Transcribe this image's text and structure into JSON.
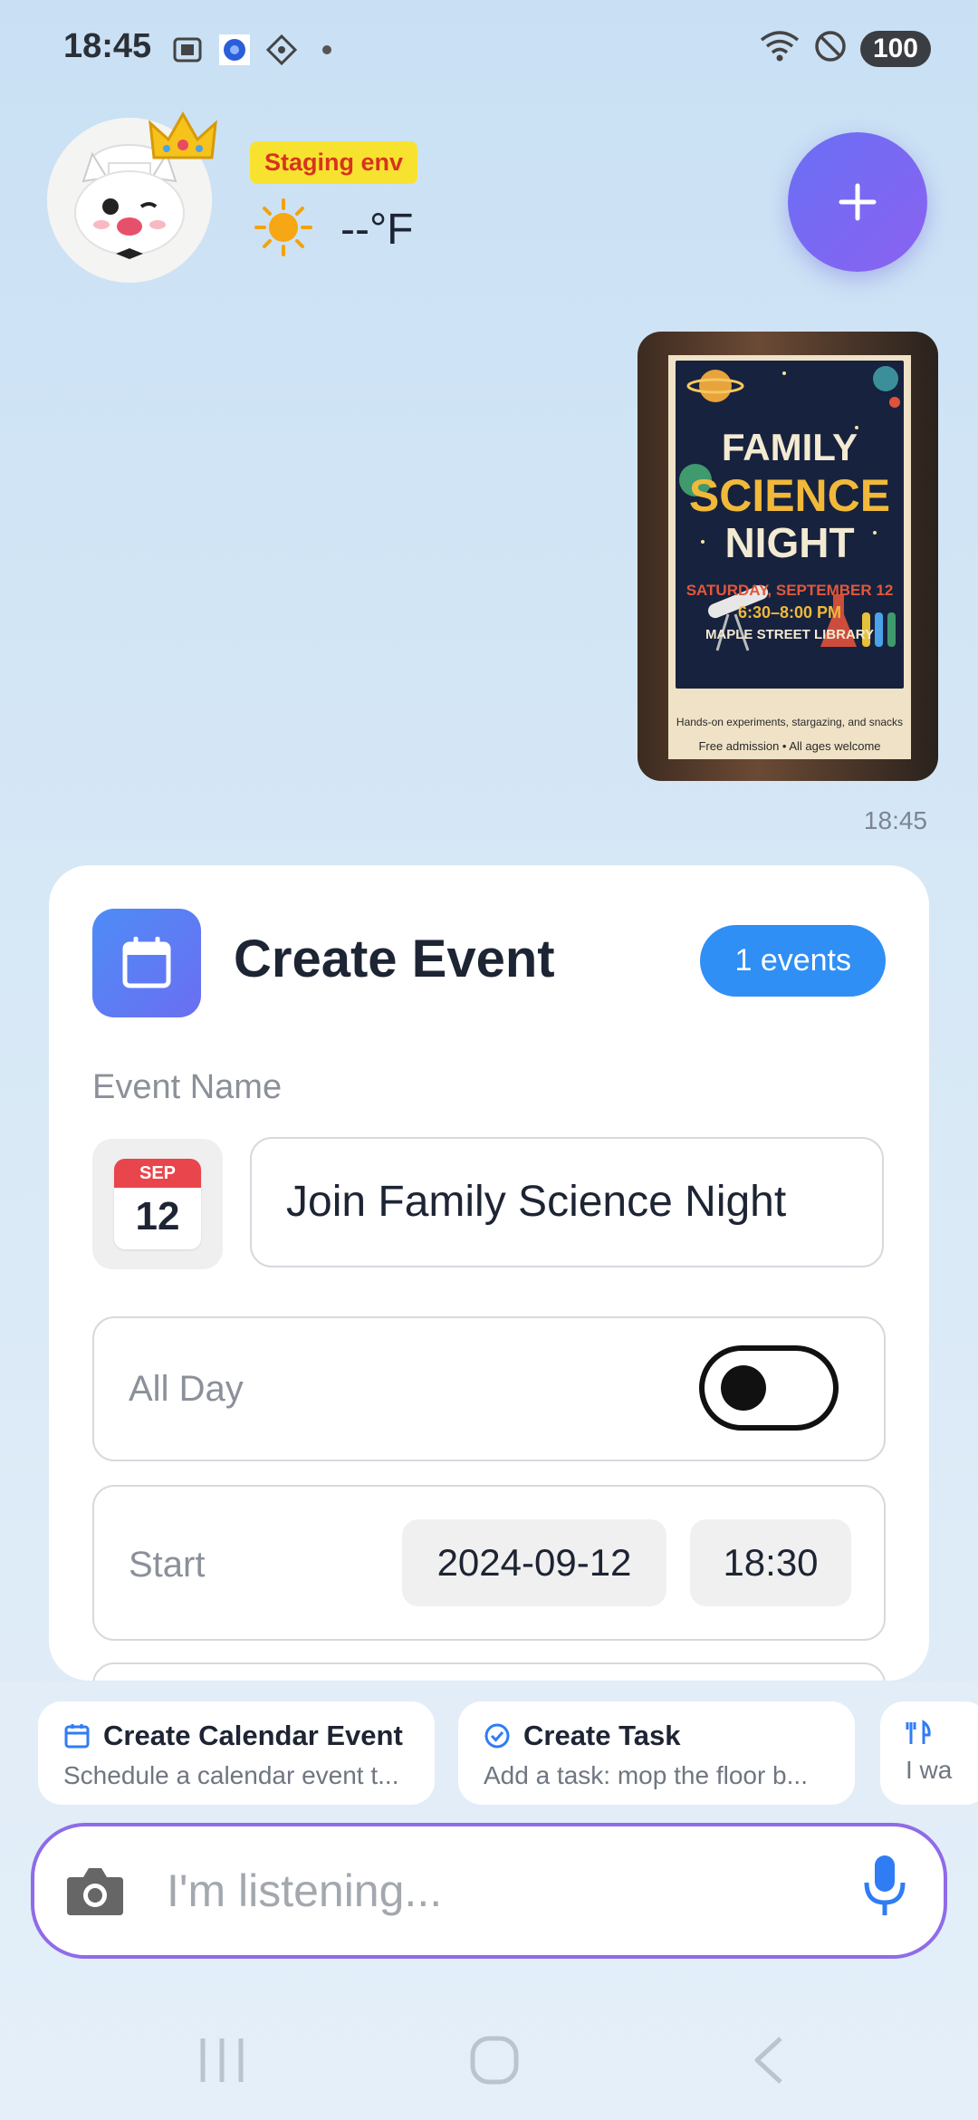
{
  "status_bar": {
    "time": "18:45",
    "battery": "100"
  },
  "header": {
    "env_badge": "Staging env",
    "temperature": "--°F"
  },
  "message": {
    "time": "18:45"
  },
  "poster": {
    "line1": "FAMILY",
    "line2": "SCIENCE",
    "line3": "NIGHT",
    "date": "SATURDAY, SEPTEMBER 12",
    "hours": "6:30–8:00 PM",
    "place": "MAPLE STREET LIBRARY",
    "note": "Hands-on experiments, stargazing, and snacks",
    "footer": "Free admission • All ages welcome"
  },
  "card": {
    "title": "Create Event",
    "events_count": "1 events",
    "event_name_label": "Event Name",
    "month": "SEP",
    "day": "12",
    "event_name_value": "Join Family Science Night",
    "all_day_label": "All Day",
    "all_day_on": false,
    "start_label": "Start",
    "start_date": "2024-09-12",
    "start_time": "18:30"
  },
  "suggestions": [
    {
      "title": "Create Calendar Event",
      "subtitle": "Schedule a calendar event t...",
      "icon": "calendar-icon"
    },
    {
      "title": "Create Task",
      "subtitle": "Add a task: mop the floor b...",
      "icon": "check-circle-icon"
    },
    {
      "title": "",
      "subtitle": "I wa",
      "icon": "restaurant-icon"
    }
  ],
  "input": {
    "placeholder": "I'm listening..."
  },
  "colors": {
    "accent": "#2f8ff5",
    "fab": "#7468f3",
    "input_border": "#8f6be8",
    "env_badge_bg": "#f7e32f",
    "env_badge_text": "#d8331f"
  }
}
